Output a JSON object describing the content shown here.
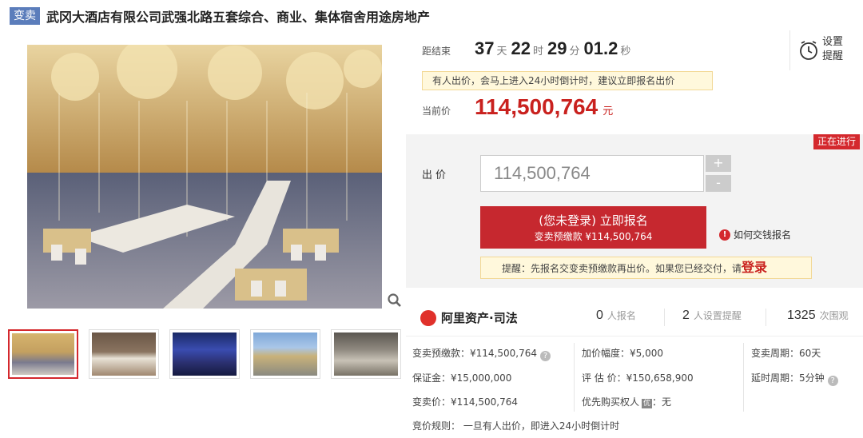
{
  "header": {
    "tag": "变卖",
    "title": "武冈大酒店有限公司武强北路五套综合、商业、集体宿舍用途房地产"
  },
  "countdown": {
    "label": "距结束",
    "days": "37",
    "days_unit": "天",
    "hours": "22",
    "hours_unit": "时",
    "minutes": "29",
    "minutes_unit": "分",
    "seconds": "01.2",
    "seconds_unit": "秒"
  },
  "reminder": {
    "line1": "设置",
    "line2": "提醒",
    "icon": "alarm-clock-icon"
  },
  "notice": "有人出价，会马上进入24小时倒计时，建议立即报名出价",
  "current_price": {
    "label": "当前价",
    "value": "114,500,764",
    "unit": "元"
  },
  "bid": {
    "status": "正在进行",
    "label": "出价",
    "input_value": "114,500,764",
    "plus": "+",
    "minus": "-",
    "signup_main": "(您未登录) 立即报名",
    "signup_sub": "变卖预缴款 ¥114,500,764",
    "howto": "如何交钱报名",
    "tip_text": "提醒：先报名交变卖预缴款再出价。如果您已经交付，请",
    "tip_link": "登录"
  },
  "brand": {
    "name": "阿里资产·司法",
    "icon": "ali-logo-icon"
  },
  "stats": [
    {
      "num": "0",
      "label": "人报名"
    },
    {
      "num": "2",
      "label": "人设置提醒"
    },
    {
      "num": "1325",
      "label": "次围观"
    }
  ],
  "info": {
    "deposit_label": "变卖预缴款：",
    "deposit_value": "¥114,500,764",
    "margin_label": "保证金：",
    "margin_value": "¥15,000,000",
    "sale_price_label": "变卖价：",
    "sale_price_value": "¥114,500,764",
    "increment_label": "加价幅度：",
    "increment_value": "¥5,000",
    "appraisal_label": "评 估 价：",
    "appraisal_value": "¥150,658,900",
    "priority_label": "优先购买权人",
    "priority_badge": "优",
    "priority_value": "：无",
    "period_label": "变卖周期：",
    "period_value": "60天",
    "delay_label": "延时周期：",
    "delay_value": "5分钟"
  },
  "rule": "竞价规则：  一旦有人出价，即进入24小时倒计时",
  "colors": {
    "accent": "#c9211e",
    "tag": "#5b7dbb",
    "notice_bg": "#fff8dc"
  }
}
